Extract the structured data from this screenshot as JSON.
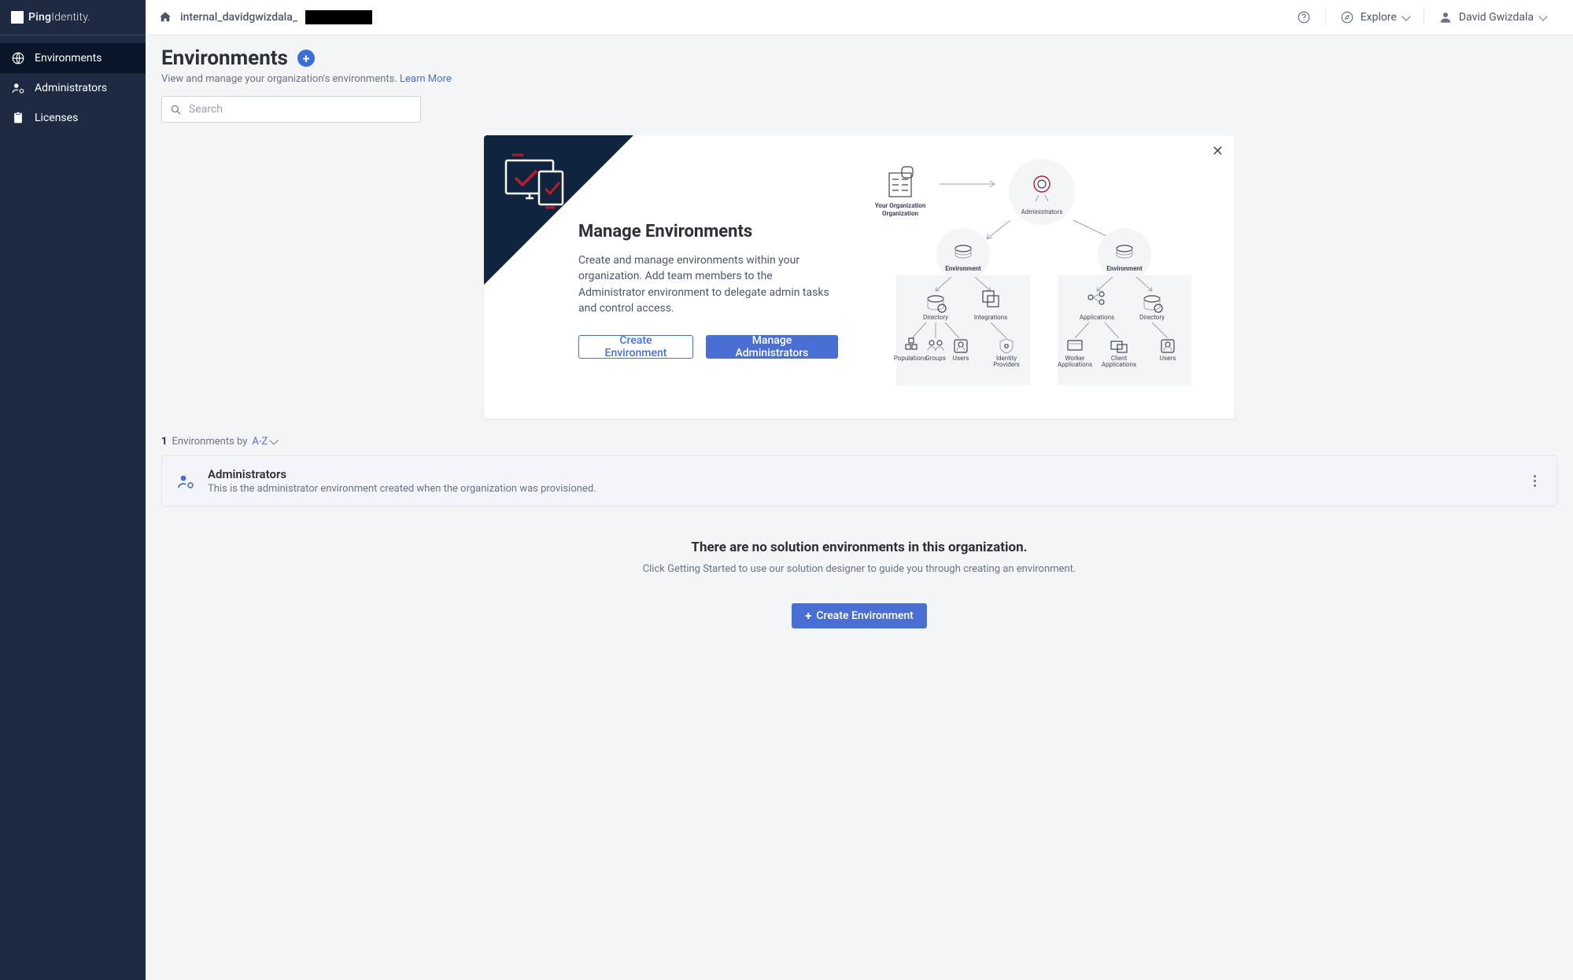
{
  "brand": {
    "name": "Ping",
    "suffix": "Identity."
  },
  "sidebar": {
    "items": [
      {
        "label": "Environments",
        "active": true
      },
      {
        "label": "Administrators",
        "active": false
      },
      {
        "label": "Licenses",
        "active": false
      }
    ]
  },
  "breadcrumb": {
    "text": "internal_davidgwizdala_"
  },
  "topbar": {
    "explore": "Explore",
    "user_name": "David Gwizdala"
  },
  "header": {
    "title": "Environments",
    "subtitle": "View and manage your organization's environments.",
    "learn_more": "Learn More",
    "search_placeholder": "Search"
  },
  "hero": {
    "title": "Manage Environments",
    "description": "Create and manage environments within your organization. Add team members to the Administrator environment to delegate admin tasks and control access.",
    "create_btn": "Create Environment",
    "manage_btn": "Manage Administrators",
    "diagram": {
      "org": "Your Organization",
      "administrators": "Administrators",
      "environment": "Environment",
      "directory": "Directory",
      "integrations": "Integrations",
      "populations": "Populations",
      "groups": "Groups",
      "users": "Users",
      "identity_providers": "Identity Providers",
      "applications": "Applications",
      "worker_applications": "Worker Applications",
      "client_applications": "Client Applications"
    }
  },
  "list": {
    "count": "1",
    "label": "Environments by",
    "sort": "A-Z",
    "rows": [
      {
        "title": "Administrators",
        "description": "This is the administrator environment created when the organization was provisioned."
      }
    ]
  },
  "empty": {
    "title": "There are no solution environments in this organization.",
    "subtitle": "Click Getting Started to use our solution designer to guide you through creating an environment.",
    "button": "Create Environment"
  }
}
